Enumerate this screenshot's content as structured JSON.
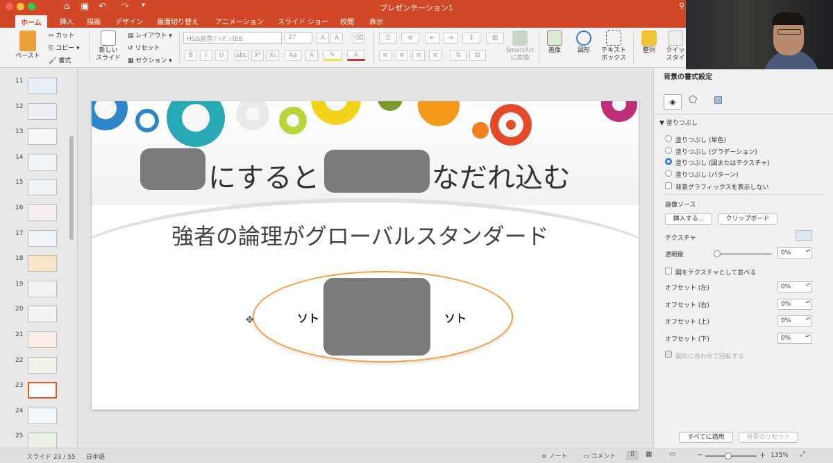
{
  "window": {
    "title": "プレゼンテーション1"
  },
  "tabs": [
    "ホーム",
    "挿入",
    "描画",
    "デザイン",
    "画面切り替え",
    "アニメーション",
    "スライド ショー",
    "校閲",
    "表示"
  ],
  "ribbon": {
    "paste": "ペースト",
    "cut": "カット",
    "copy": "コピー",
    "format": "書式",
    "new_slide_1": "新しい",
    "new_slide_2": "スライド",
    "layout": "レイアウト",
    "reset": "リセット",
    "section": "セクション",
    "font_name": "HGS創英ﾌﾟﾚｾﾞﾝｽEB",
    "font_size": "27",
    "smartart_1": "SmartArt",
    "smartart_2": "に変換",
    "image": "画像",
    "shape": "図形",
    "textbox_1": "テキスト",
    "textbox_2": "ボックス",
    "arrange": "整列",
    "quick_1": "クイッ",
    "quick_2": "スタイ",
    "font_buttons": [
      "B",
      "I",
      "U",
      "abc",
      "X²",
      "X₂",
      "Aa",
      "A",
      "A"
    ]
  },
  "thumbnails": [
    "11",
    "12",
    "13",
    "14",
    "15",
    "16",
    "17",
    "18",
    "19",
    "20",
    "21",
    "22",
    "23",
    "24",
    "25"
  ],
  "selected_slide": "23",
  "slide": {
    "title_a": "にすると",
    "title_b": "なだれ込む",
    "subtitle": "強者の論理がグローバルスタンダード",
    "left_label": "ソト",
    "right_label": "ソト"
  },
  "pane": {
    "header": "背景の書式設定",
    "fill_section": "塗りつぶし",
    "options": [
      "塗りつぶし (単色)",
      "塗りつぶし (グラデーション)",
      "塗りつぶし (図またはテクスチャ)",
      "塗りつぶし (パターン)"
    ],
    "selected_option": 2,
    "hide_bg": "背景グラフィックスを表示しない",
    "image_source": "画像ソース",
    "insert_btn": "挿入する...",
    "clipboard_btn": "クリップボード",
    "texture": "テクスチャ",
    "transparency": "透明度",
    "transparency_val": "0%",
    "tile": "図をテクスチャとして並べる",
    "offsets": [
      {
        "label": "オフセット (左)",
        "value": "0%"
      },
      {
        "label": "オフセット (右)",
        "value": "0%"
      },
      {
        "label": "オフセット (上)",
        "value": "0%"
      },
      {
        "label": "オフセット (下)",
        "value": "0%"
      }
    ],
    "rotate": "図形に合わせて回転する",
    "apply_all": "すべてに適用",
    "reset_bg": "背景のリセット"
  },
  "status": {
    "slide_info": "スライド 23 / 55",
    "language": "日本語",
    "notes": "ノート",
    "comments": "コメント",
    "zoom": "135%"
  },
  "colors": {
    "accent": "#d24726",
    "selection": "#e05a1c",
    "ellipse": "#f0a040"
  }
}
